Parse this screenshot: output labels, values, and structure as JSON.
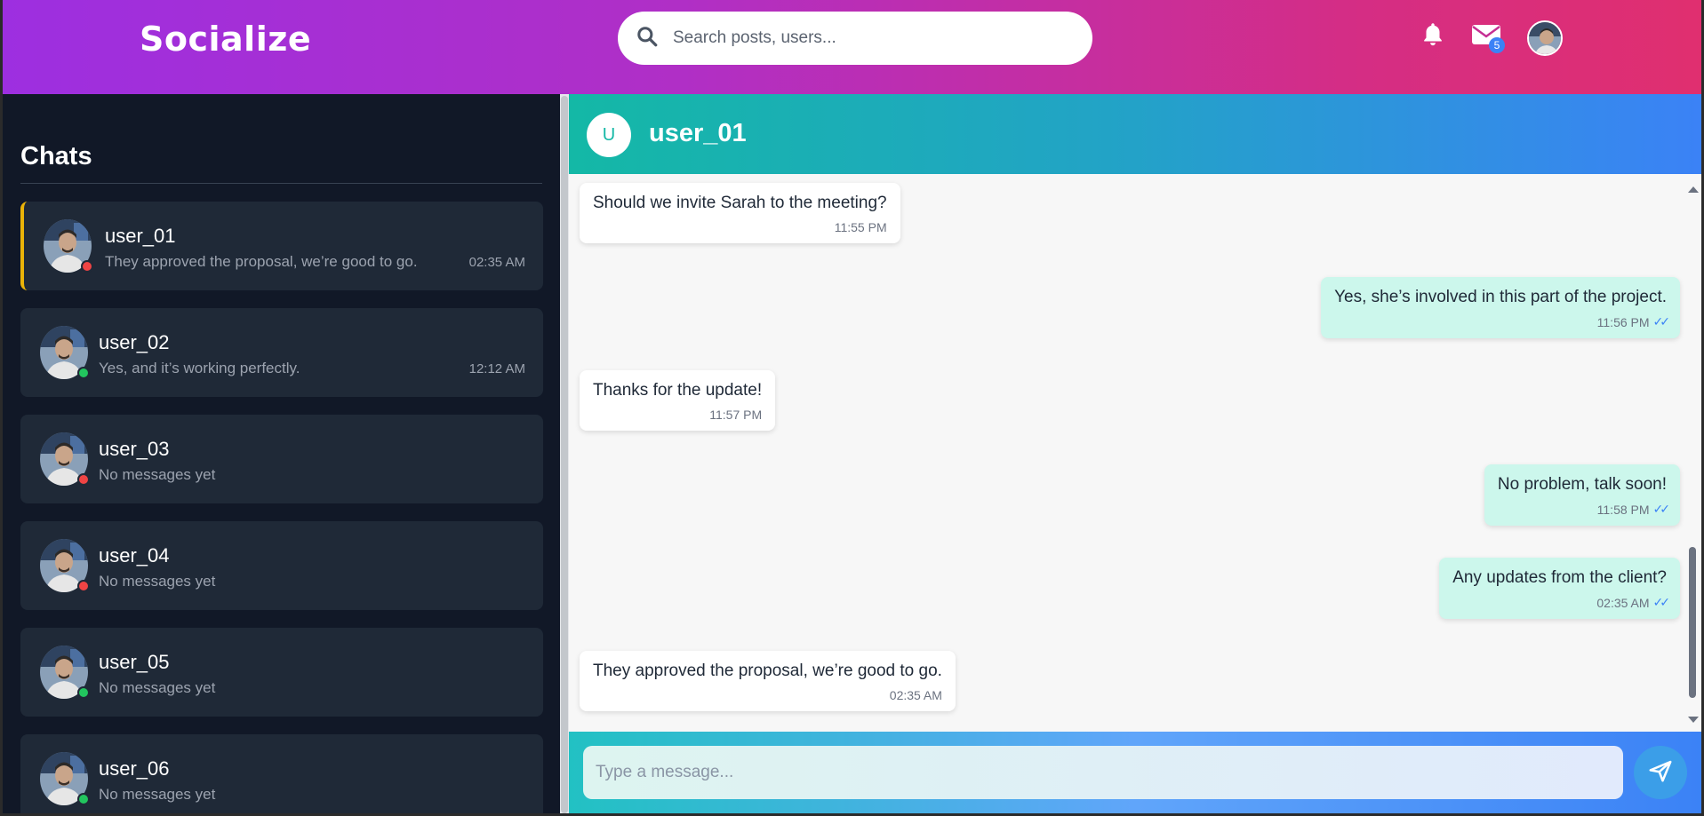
{
  "header": {
    "logo": "Socialize",
    "search_placeholder": "Search posts, users...",
    "mail_badge": "5"
  },
  "sidebar": {
    "title": "Chats",
    "chats": [
      {
        "name": "user_01",
        "preview": "They approved the proposal, we’re good to go.",
        "time": "02:35 AM",
        "status": "offline",
        "active": true
      },
      {
        "name": "user_02",
        "preview": "Yes, and it’s working perfectly.",
        "time": "12:12 AM",
        "status": "online",
        "active": false
      },
      {
        "name": "user_03",
        "preview": "No messages yet",
        "time": "",
        "status": "offline",
        "active": false
      },
      {
        "name": "user_04",
        "preview": "No messages yet",
        "time": "",
        "status": "offline",
        "active": false
      },
      {
        "name": "user_05",
        "preview": "No messages yet",
        "time": "",
        "status": "online",
        "active": false
      },
      {
        "name": "user_06",
        "preview": "No messages yet",
        "time": "",
        "status": "online",
        "active": false
      }
    ]
  },
  "chat": {
    "avatar_letter": "U",
    "name": "user_01",
    "messages": [
      {
        "direction": "in",
        "text": "Should we invite Sarah to the meeting?",
        "time": "11:55 PM"
      },
      {
        "direction": "out",
        "text": "Yes, she’s involved in this part of the project.",
        "time": "11:56 PM",
        "ticks": "✓✓"
      },
      {
        "direction": "in",
        "text": "Thanks for the update!",
        "time": "11:57 PM"
      },
      {
        "direction": "out",
        "text": "No problem, talk soon!",
        "time": "11:58 PM",
        "ticks": "✓✓"
      },
      {
        "direction": "out",
        "text": "Any updates from the client?",
        "time": "02:35 AM",
        "ticks": "✓✓"
      },
      {
        "direction": "in",
        "text": "They approved the proposal, we’re good to go.",
        "time": "02:35 AM"
      }
    ],
    "composer_placeholder": "Type a message..."
  },
  "colors": {
    "status_online": "#22c55e",
    "status_offline": "#ef4444",
    "active_accent": "#eab308"
  }
}
